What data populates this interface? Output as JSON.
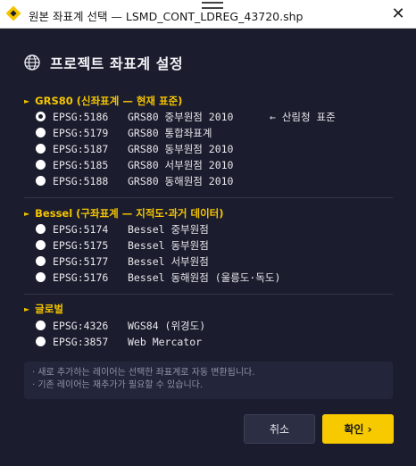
{
  "window": {
    "title": "원본 좌표계 선택 — LSMD_CONT_LDREG_43720.shp",
    "close_glyph": "✕"
  },
  "header": {
    "title": "프로젝트 좌표계 설정",
    "icon": "globe-icon"
  },
  "sections": [
    {
      "heading": "GRS80 (신좌표계 — 현재 표준)",
      "options": [
        {
          "code": "EPSG:5186",
          "desc": "GRS80 중부원점 2010",
          "note": "← 산림청 표준",
          "checked": true
        },
        {
          "code": "EPSG:5179",
          "desc": "GRS80 통합좌표계",
          "checked": false
        },
        {
          "code": "EPSG:5187",
          "desc": "GRS80 동부원점 2010",
          "checked": false
        },
        {
          "code": "EPSG:5185",
          "desc": "GRS80 서부원점 2010",
          "checked": false
        },
        {
          "code": "EPSG:5188",
          "desc": "GRS80 동해원점 2010",
          "checked": false
        }
      ]
    },
    {
      "heading": "Bessel (구좌표계 — 지적도·과거 데이터)",
      "options": [
        {
          "code": "EPSG:5174",
          "desc": "Bessel 중부원점",
          "checked": false
        },
        {
          "code": "EPSG:5175",
          "desc": "Bessel 동부원점",
          "checked": false
        },
        {
          "code": "EPSG:5177",
          "desc": "Bessel 서부원점",
          "checked": false
        },
        {
          "code": "EPSG:5176",
          "desc": "Bessel 동해원점 (울릉도·독도)",
          "checked": false
        }
      ]
    },
    {
      "heading": "글로벌",
      "options": [
        {
          "code": "EPSG:4326",
          "desc": "WGS84 (위경도)",
          "checked": false
        },
        {
          "code": "EPSG:3857",
          "desc": "Web Mercator",
          "checked": false
        }
      ]
    }
  ],
  "info": {
    "line1": "· 새로 추가하는 레이어는 선택한 좌표계로 자동 변환됩니다.",
    "line2": "· 기존 레이어는 재추가가 필요할 수 있습니다."
  },
  "buttons": {
    "cancel": "취소",
    "ok": "확인 ›"
  },
  "colors": {
    "accent": "#f7ca00",
    "background": "#1b1d2e"
  }
}
